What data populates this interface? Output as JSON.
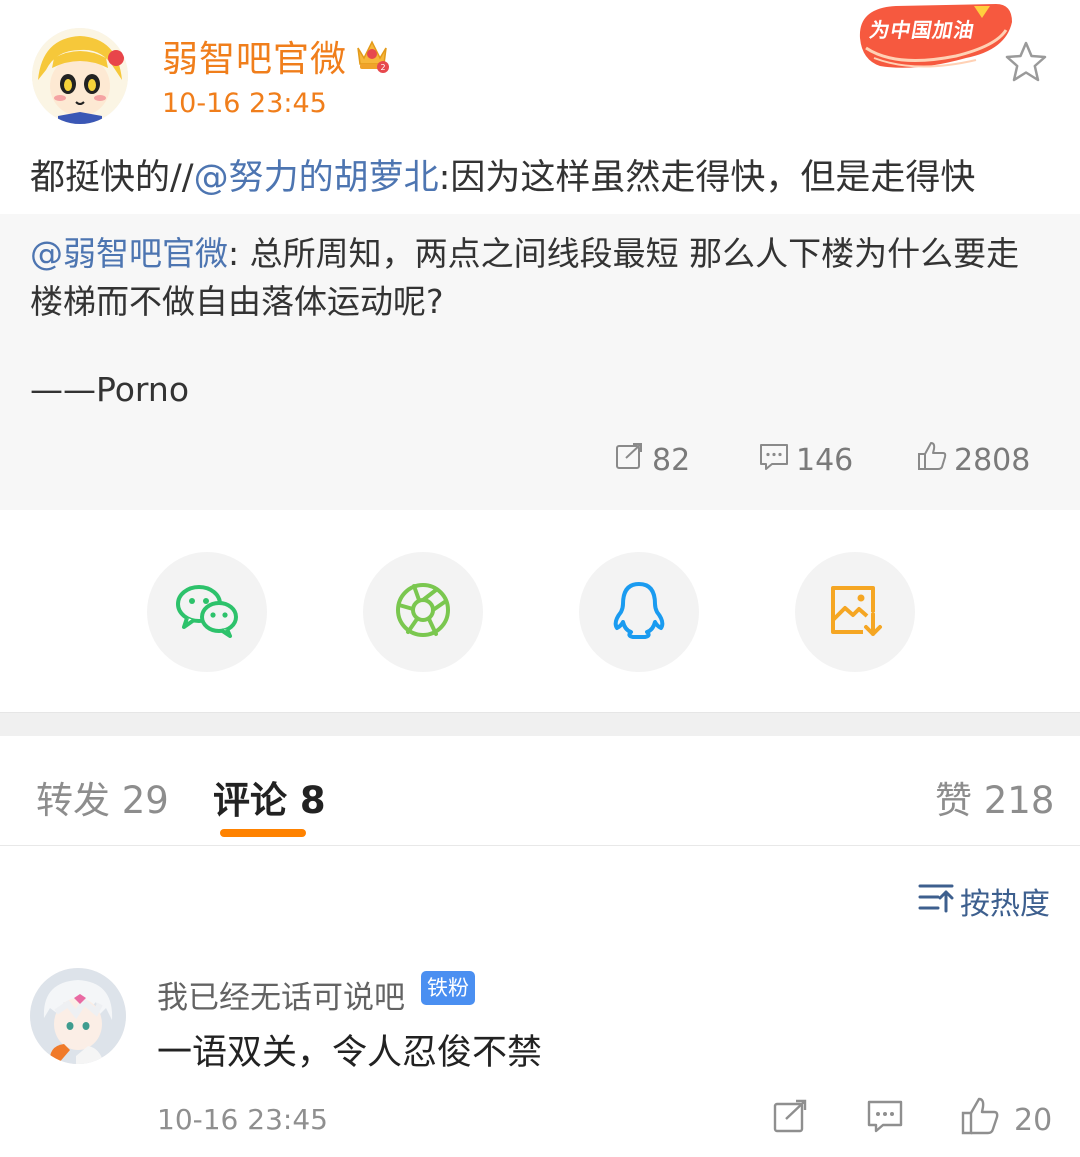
{
  "post": {
    "author_name": "弱智吧官微",
    "time": "10-16 23:45",
    "badge_text": "为中国加油",
    "repost_prefix": "都挺快的//",
    "repost_mention": "@努力的胡萝北",
    "repost_body": ":因为这样虽然走得快，但是走得快",
    "original": {
      "mention": "@弱智吧官微",
      "text": ": 总所周知，两点之间线段最短 那么人下楼为什么要走楼梯而不做自由落体运动呢?",
      "signature": "——Porno",
      "reposts": "82",
      "comments": "146",
      "likes": "2808"
    }
  },
  "share": {
    "items": [
      {
        "icon": "wechat-icon"
      },
      {
        "icon": "moments-icon"
      },
      {
        "icon": "qq-icon"
      },
      {
        "icon": "save-image-icon"
      }
    ]
  },
  "tabs": {
    "repost_label": "转发 29",
    "comment_label": "评论 8",
    "like_label": "赞 218"
  },
  "sort": {
    "label": "按热度"
  },
  "comments": [
    {
      "user": "我已经无话可说吧",
      "badge": "铁粉",
      "text": "一语双关，令人忍俊不禁",
      "time": "10-16 23:45",
      "likes": "20"
    }
  ],
  "colors": {
    "accent_orange": "#f07e1b",
    "tab_indicator": "#ff8200",
    "mention_blue": "#4d75b1",
    "fan_badge_blue": "#4a8ff1",
    "wechat_green": "#2dc26b",
    "moments_green": "#7ac74f",
    "qq_blue": "#1a9bf0",
    "save_orange": "#f5a623"
  }
}
